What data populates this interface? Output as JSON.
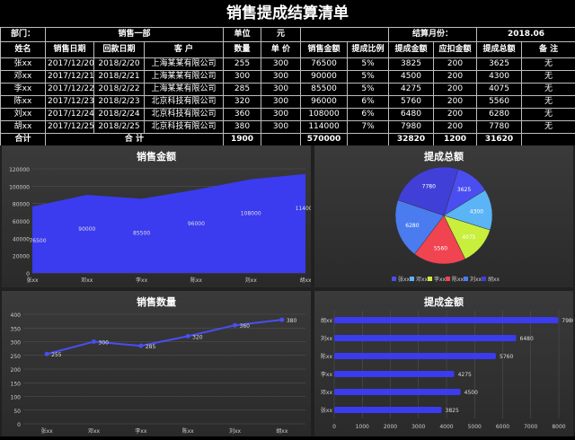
{
  "title": "销售提成结算清单",
  "meta": {
    "dept_label": "部门：",
    "dept_value": "销售一部",
    "unit_label": "单位",
    "unit_value": "元",
    "month_label": "结算月份：",
    "month_value": "2018.06"
  },
  "columns": [
    "姓名",
    "销售日期",
    "回款日期",
    "客  户",
    "数量",
    "单 价",
    "销售金额",
    "提成比例",
    "提成金额",
    "应扣金额",
    "提成总额",
    "备  注"
  ],
  "rows": [
    [
      "张xx",
      "2017/12/20",
      "2018/2/20",
      "上海某某有限公司",
      "255",
      "300",
      "76500",
      "5%",
      "3825",
      "200",
      "3625",
      "无"
    ],
    [
      "邓xx",
      "2017/12/21",
      "2018/2/21",
      "上海某某有限公司",
      "300",
      "300",
      "90000",
      "5%",
      "4500",
      "200",
      "4300",
      "无"
    ],
    [
      "李xx",
      "2017/12/22",
      "2018/2/22",
      "上海某某有限公司",
      "285",
      "300",
      "85500",
      "5%",
      "4275",
      "200",
      "4075",
      "无"
    ],
    [
      "陈xx",
      "2017/12/23",
      "2018/2/23",
      "北京科技有限公司",
      "320",
      "300",
      "96000",
      "6%",
      "5760",
      "200",
      "5560",
      "无"
    ],
    [
      "刘xx",
      "2017/12/24",
      "2018/2/24",
      "北京科技有限公司",
      "360",
      "300",
      "108000",
      "6%",
      "6480",
      "200",
      "6280",
      "无"
    ],
    [
      "胡xx",
      "2017/12/25",
      "2018/2/25",
      "北京科技有限公司",
      "380",
      "300",
      "114000",
      "7%",
      "7980",
      "200",
      "7780",
      "无"
    ]
  ],
  "total": {
    "label": "合计",
    "label2": "合    计",
    "qty": "1900",
    "sales": "570000",
    "commission": "32820",
    "deduct": "1200",
    "net": "31620"
  },
  "chart_data": [
    {
      "type": "area",
      "title": "销售金额",
      "categories": [
        "张xx",
        "邓xx",
        "李xx",
        "陈xx",
        "刘xx",
        "胡xx"
      ],
      "values": [
        76500,
        90000,
        85500,
        96000,
        108000,
        114000
      ],
      "ylim": [
        0,
        120000
      ],
      "yticks": [
        "0",
        "20000",
        "40000",
        "60000",
        "80000",
        "100000",
        "120000"
      ],
      "color": "#3b3bf0"
    },
    {
      "type": "pie",
      "title": "提成总额",
      "categories": [
        "张xx",
        "邓xx",
        "李xx",
        "陈xx",
        "刘xx",
        "胡xx"
      ],
      "values": [
        3625,
        4300,
        4075,
        5560,
        6280,
        7780
      ],
      "colors": [
        "#4a4ef0",
        "#5ab4f5",
        "#c8ef3c",
        "#f04450",
        "#4a7cf0",
        "#4040d8"
      ],
      "legend": "bottom"
    },
    {
      "type": "line",
      "title": "销售数量",
      "categories": [
        "张xx",
        "邓xx",
        "李xx",
        "陈xx",
        "刘xx",
        "胡xx"
      ],
      "values": [
        255,
        300,
        285,
        320,
        360,
        380
      ],
      "ylim": [
        0,
        400
      ],
      "yticks": [
        "0",
        "50",
        "100",
        "150",
        "200",
        "250",
        "300",
        "350",
        "400"
      ],
      "color": "#4a4ef0"
    },
    {
      "type": "bar",
      "title": "提成金额",
      "categories": [
        "胡xx",
        "刘xx",
        "陈xx",
        "李xx",
        "邓xx",
        "张xx"
      ],
      "values": [
        7980,
        6480,
        5760,
        4275,
        4500,
        3825
      ],
      "xlim": [
        0,
        8000
      ],
      "xticks": [
        "0",
        "1000",
        "2000",
        "3000",
        "4000",
        "5000",
        "6000",
        "7000",
        "8000"
      ],
      "color": "#3b3bf0"
    }
  ]
}
